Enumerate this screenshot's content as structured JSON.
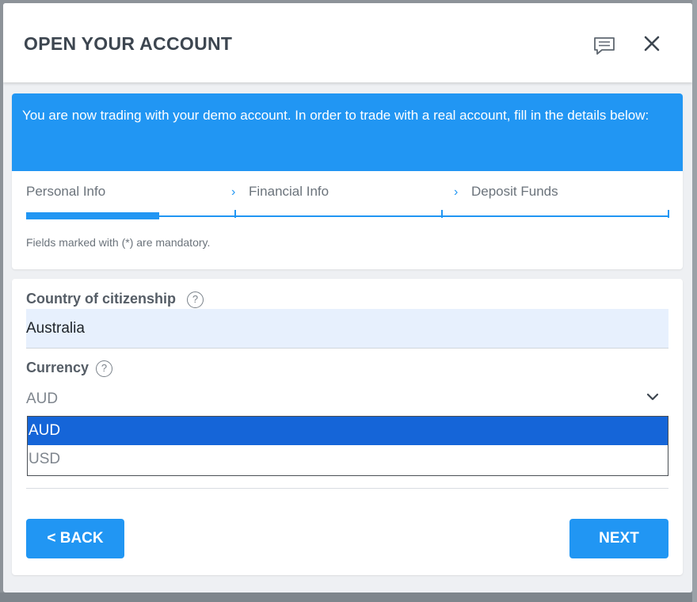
{
  "modal": {
    "title": "OPEN YOUR ACCOUNT"
  },
  "banner": {
    "text": "You are now trading with your demo account. In order to trade with a real account, fill in the details below:"
  },
  "steps": [
    {
      "label": "Personal Info",
      "active": true
    },
    {
      "label": "Financial Info",
      "active": false
    },
    {
      "label": "Deposit Funds",
      "active": false
    }
  ],
  "note": "Fields marked with (*) are mandatory.",
  "form": {
    "country": {
      "label": "Country of citizenship",
      "value": "Australia"
    },
    "currency": {
      "label": "Currency",
      "value": "AUD",
      "options": [
        "AUD",
        "USD"
      ],
      "selected": "AUD"
    }
  },
  "buttons": {
    "back": "< BACK",
    "next": "NEXT"
  },
  "icons": {
    "chat": "chat-icon",
    "close": "close-icon",
    "help": "help-icon",
    "chevron": "chevron-down-icon",
    "step_arrow": "chevron-right-icon"
  },
  "colors": {
    "accent": "#2196f3",
    "selected_option": "#1565d8",
    "title": "#3d4650",
    "input_bg": "#e7f0fd"
  }
}
